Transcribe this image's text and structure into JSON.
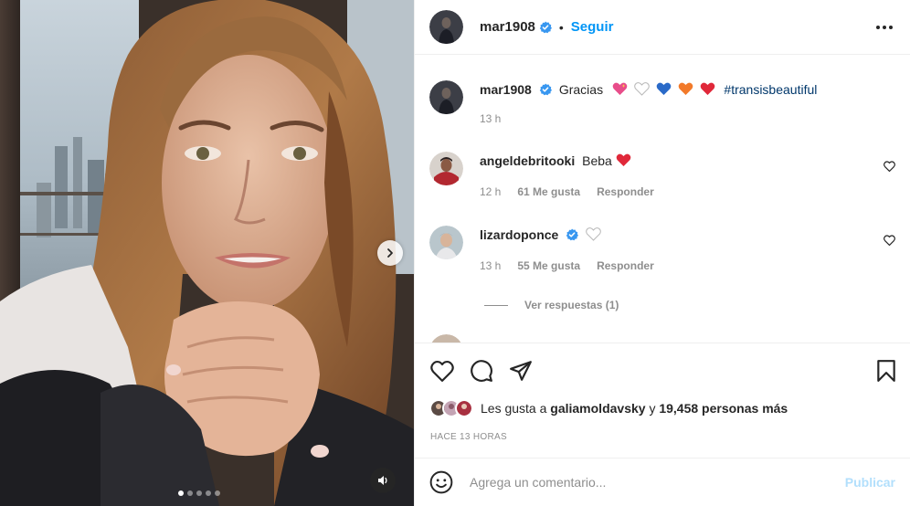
{
  "post": {
    "author": "mar1908",
    "follow_label": "Seguir",
    "separator": "•",
    "caption_text": "Gracias",
    "caption_hashtag": "#transisbeautiful",
    "caption_time": "13 h",
    "carousel_count": 5,
    "carousel_active": 0
  },
  "comments": [
    {
      "user": "angeldebritooki",
      "verified": false,
      "text": "Beba",
      "time": "12 h",
      "likes": "61 Me gusta",
      "reply": "Responder"
    },
    {
      "user": "lizardoponce",
      "verified": true,
      "text": "",
      "time": "13 h",
      "likes": "55 Me gusta",
      "reply": "Responder"
    }
  ],
  "view_replies": "Ver respuestas (1)",
  "likes_line": {
    "prefix": "Les gusta a",
    "user": "galiamoldavsky",
    "connector": "y",
    "count": "19,458 personas más"
  },
  "timestamp": "HACE 13 HORAS",
  "add_comment": {
    "placeholder": "Agrega un comentario...",
    "publish_label": "Publicar"
  },
  "colors": {
    "link": "#0095f6",
    "hashtag": "#00376b",
    "muted": "#8e8e8e",
    "verified": "#3897f0",
    "publish_disabled": "#b2dffc"
  },
  "icons": [
    "verified-badge-icon",
    "more-options-icon",
    "heart-icon",
    "comment-icon",
    "share-icon",
    "bookmark-icon",
    "emoji-icon",
    "chevron-right-icon",
    "speaker-icon"
  ]
}
